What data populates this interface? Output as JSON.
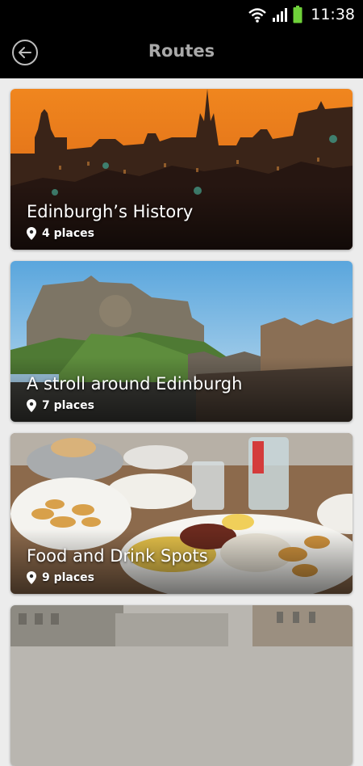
{
  "status_bar": {
    "time": "11:38"
  },
  "header": {
    "title": "Routes"
  },
  "routes": [
    {
      "title": "Edinburgh’s History",
      "places": "4 places",
      "image": "edinburgh-skyline-sunset"
    },
    {
      "title": "A stroll around Edinburgh",
      "places": "7 places",
      "image": "edinburgh-castle-hill"
    },
    {
      "title": "Food and Drink Spots",
      "places": "9 places",
      "image": "food-table"
    },
    {
      "title": "",
      "places": "",
      "image": "city-street-aerial"
    }
  ],
  "colors": {
    "header_bg": "#000000",
    "title_text": "#a9a9a9",
    "page_bg": "#ececec"
  }
}
